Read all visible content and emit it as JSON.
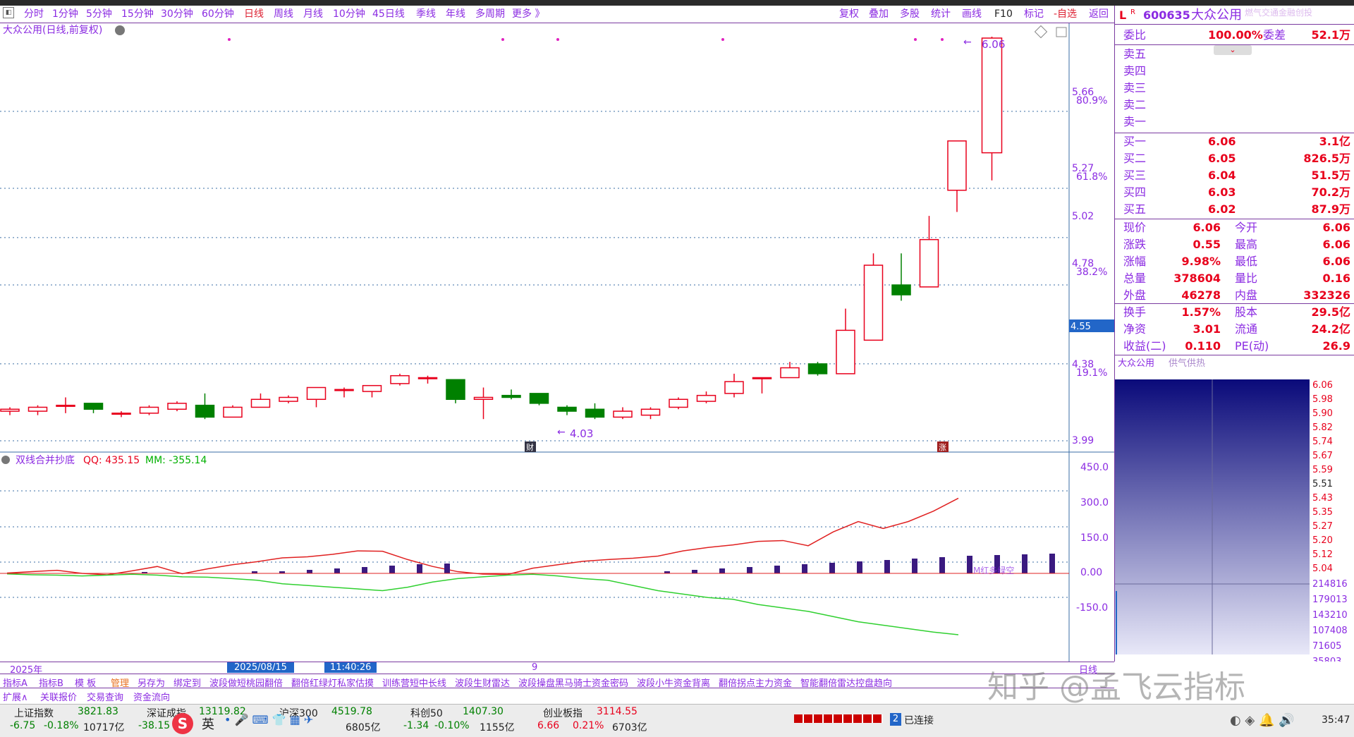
{
  "toolbar": {
    "periods": [
      "分时",
      "1分钟",
      "5分钟",
      "15分钟",
      "30分钟",
      "60分钟",
      "日线",
      "周线",
      "月线",
      "10分钟",
      "45日线",
      "季线",
      "年线",
      "多周期",
      "更多 》"
    ],
    "selected_period": "日线",
    "actions": [
      "复权",
      "叠加",
      "多股",
      "统计",
      "画线",
      "F10",
      "标记",
      "-自选",
      "返回"
    ]
  },
  "chart": {
    "title": "大众公用(日线,前复权)",
    "price_labels": [
      "6.06",
      "5.66",
      "5.27",
      "5.02",
      "4.78",
      "4.55",
      "4.38",
      "3.99"
    ],
    "pct_labels": [
      "80.9%",
      "61.8%",
      "38.2%",
      "19.1%"
    ],
    "current_price_tag": "4.55",
    "max_annotation": "6.06",
    "min_annotation": "4.03",
    "fin_marker": "财",
    "limit_marker": "涨",
    "indicator_name": "双线合并抄底",
    "indicator_qq_label": "QQ: 435.15",
    "indicator_mm_label": "MM: -355.14",
    "indicator_axis": [
      "450.0",
      "300.0",
      "150.0",
      "0.00",
      "-150.0"
    ],
    "indicator_note": "M红多绿空",
    "time_labels": [
      "2025年",
      "2025/08/15",
      "11:40:26",
      "9"
    ],
    "time_right": "日线"
  },
  "chart_data": {
    "type": "candlestick",
    "ylim": [
      3.99,
      6.06
    ],
    "candles": [
      {
        "o": 4.14,
        "h": 4.16,
        "l": 4.12,
        "c": 4.15
      },
      {
        "o": 4.14,
        "h": 4.17,
        "l": 4.12,
        "c": 4.16
      },
      {
        "o": 4.17,
        "h": 4.21,
        "l": 4.13,
        "c": 4.17
      },
      {
        "o": 4.18,
        "h": 4.18,
        "l": 4.13,
        "c": 4.15
      },
      {
        "o": 4.13,
        "h": 4.14,
        "l": 4.11,
        "c": 4.13
      },
      {
        "o": 4.13,
        "h": 4.17,
        "l": 4.12,
        "c": 4.16
      },
      {
        "o": 4.15,
        "h": 4.19,
        "l": 4.14,
        "c": 4.18
      },
      {
        "o": 4.17,
        "h": 4.23,
        "l": 4.1,
        "c": 4.11
      },
      {
        "o": 4.11,
        "h": 4.17,
        "l": 4.11,
        "c": 4.16
      },
      {
        "o": 4.16,
        "h": 4.23,
        "l": 4.16,
        "c": 4.2
      },
      {
        "o": 4.19,
        "h": 4.22,
        "l": 4.18,
        "c": 4.21
      },
      {
        "o": 4.2,
        "h": 4.26,
        "l": 4.16,
        "c": 4.26
      },
      {
        "o": 4.25,
        "h": 4.26,
        "l": 4.21,
        "c": 4.25
      },
      {
        "o": 4.24,
        "h": 4.27,
        "l": 4.21,
        "c": 4.27
      },
      {
        "o": 4.28,
        "h": 4.33,
        "l": 4.27,
        "c": 4.32
      },
      {
        "o": 4.31,
        "h": 4.32,
        "l": 4.28,
        "c": 4.31
      },
      {
        "o": 4.3,
        "h": 4.3,
        "l": 4.18,
        "c": 4.2
      },
      {
        "o": 4.2,
        "h": 4.26,
        "l": 4.1,
        "c": 4.21
      },
      {
        "o": 4.22,
        "h": 4.25,
        "l": 4.2,
        "c": 4.21
      },
      {
        "o": 4.23,
        "h": 4.23,
        "l": 4.17,
        "c": 4.18
      },
      {
        "o": 4.16,
        "h": 4.17,
        "l": 4.12,
        "c": 4.14
      },
      {
        "o": 4.15,
        "h": 4.18,
        "l": 4.1,
        "c": 4.11
      },
      {
        "o": 4.11,
        "h": 4.16,
        "l": 4.1,
        "c": 4.14
      },
      {
        "o": 4.12,
        "h": 4.16,
        "l": 4.1,
        "c": 4.15
      },
      {
        "o": 4.16,
        "h": 4.21,
        "l": 4.15,
        "c": 4.2
      },
      {
        "o": 4.19,
        "h": 4.24,
        "l": 4.18,
        "c": 4.22
      },
      {
        "o": 4.23,
        "h": 4.33,
        "l": 4.21,
        "c": 4.29
      },
      {
        "o": 4.31,
        "h": 4.31,
        "l": 4.23,
        "c": 4.31
      },
      {
        "o": 4.31,
        "h": 4.39,
        "l": 4.31,
        "c": 4.36
      },
      {
        "o": 4.38,
        "h": 4.39,
        "l": 4.32,
        "c": 4.33
      },
      {
        "o": 4.33,
        "h": 4.66,
        "l": 4.33,
        "c": 4.55
      },
      {
        "o": 4.5,
        "h": 4.94,
        "l": 4.5,
        "c": 4.88
      },
      {
        "o": 4.78,
        "h": 4.94,
        "l": 4.7,
        "c": 4.73
      },
      {
        "o": 4.77,
        "h": 5.13,
        "l": 4.77,
        "c": 5.01
      },
      {
        "o": 5.26,
        "h": 5.48,
        "l": 5.15,
        "c": 5.51
      }
    ]
  },
  "quote": {
    "code": "600635",
    "name": "大众公用",
    "sector": "燃气交通金融创投",
    "labels": {
      "weibi": "委比",
      "weicha": "委差"
    },
    "weibi": "100.00%",
    "weicha": "52.1万",
    "sells": [
      {
        "label": "卖五",
        "price": "",
        "vol": ""
      },
      {
        "label": "卖四",
        "price": "",
        "vol": ""
      },
      {
        "label": "卖三",
        "price": "",
        "vol": ""
      },
      {
        "label": "卖二",
        "price": "",
        "vol": ""
      },
      {
        "label": "卖一",
        "price": "",
        "vol": ""
      }
    ],
    "buys": [
      {
        "label": "买一",
        "price": "6.06",
        "vol": "3.1亿"
      },
      {
        "label": "买二",
        "price": "6.05",
        "vol": "826.5万"
      },
      {
        "label": "买三",
        "price": "6.04",
        "vol": "51.5万"
      },
      {
        "label": "买四",
        "price": "6.03",
        "vol": "70.2万"
      },
      {
        "label": "买五",
        "price": "6.02",
        "vol": "87.9万"
      }
    ],
    "stats": [
      {
        "l1": "现价",
        "v1": "6.06",
        "l2": "今开",
        "v2": "6.06"
      },
      {
        "l1": "涨跌",
        "v1": "0.55",
        "l2": "最高",
        "v2": "6.06"
      },
      {
        "l1": "涨幅",
        "v1": "9.98%",
        "l2": "最低",
        "v2": "6.06"
      },
      {
        "l1": "总量",
        "v1": "378604",
        "l2": "量比",
        "v2": "0.16"
      },
      {
        "l1": "外盘",
        "v1": "46278",
        "l2": "内盘",
        "v2": "332326"
      }
    ],
    "stats2": [
      {
        "l1": "换手",
        "v1": "1.57%",
        "l2": "股本",
        "v2": "29.5亿"
      },
      {
        "l1": "净资",
        "v1": "3.01",
        "l2": "流通",
        "v2": "24.2亿"
      },
      {
        "l1": "收益(二)",
        "v1": "0.110",
        "l2": "PE(动)",
        "v2": "26.9"
      }
    ],
    "profile_labels": [
      "大众公用",
      "供气供热"
    ],
    "profile_prices": [
      "6.06",
      "5.98",
      "5.90",
      "5.82",
      "5.74",
      "5.67",
      "5.59",
      "5.51",
      "5.43",
      "5.35",
      "5.27",
      "5.20",
      "5.12",
      "5.04"
    ],
    "profile_vols": [
      "214816",
      "179013",
      "143210",
      "107408",
      "71605",
      "35803"
    ]
  },
  "tabs1": [
    "指标A",
    "指标B",
    "模 板",
    "管理",
    "另存为",
    "绑定到",
    "波段做短桃园翻倍",
    "翻倍红绿灯私家估摸",
    "训练营短中长线",
    "波段生财雷达",
    "波段操盘黑马骑士资金密码",
    "波段小牛资金背离",
    "翻倍拐点主力资金",
    "智能翻倍雷达控盘趋向"
  ],
  "tabs2": [
    "扩展∧",
    "关联报价",
    "交易查询",
    "资金流向"
  ],
  "status": {
    "indices": [
      {
        "name": "上证指数",
        "value": "3821.83",
        "chg": "-6.75",
        "pct": "-0.18%",
        "amt": "10717亿"
      },
      {
        "name": "深证成指",
        "value": "13119.82",
        "chg": "-38.15",
        "pct": "",
        "amt": ""
      },
      {
        "name": "沪深300",
        "value": "4519.78",
        "chg": "",
        "pct": "",
        "amt": "6805亿"
      },
      {
        "name": "科创50",
        "value": "1407.30",
        "chg": "-1.34",
        "pct": "-0.10%",
        "amt": "1155亿"
      },
      {
        "name": "创业板指",
        "value": "3114.55",
        "chg": "6.66",
        "pct": "0.21%",
        "amt": "6703亿"
      }
    ],
    "connected": "已连接",
    "conn_count": "2",
    "ime": "英",
    "clock": "35:47"
  },
  "watermark": "知乎 @孟飞云指标"
}
